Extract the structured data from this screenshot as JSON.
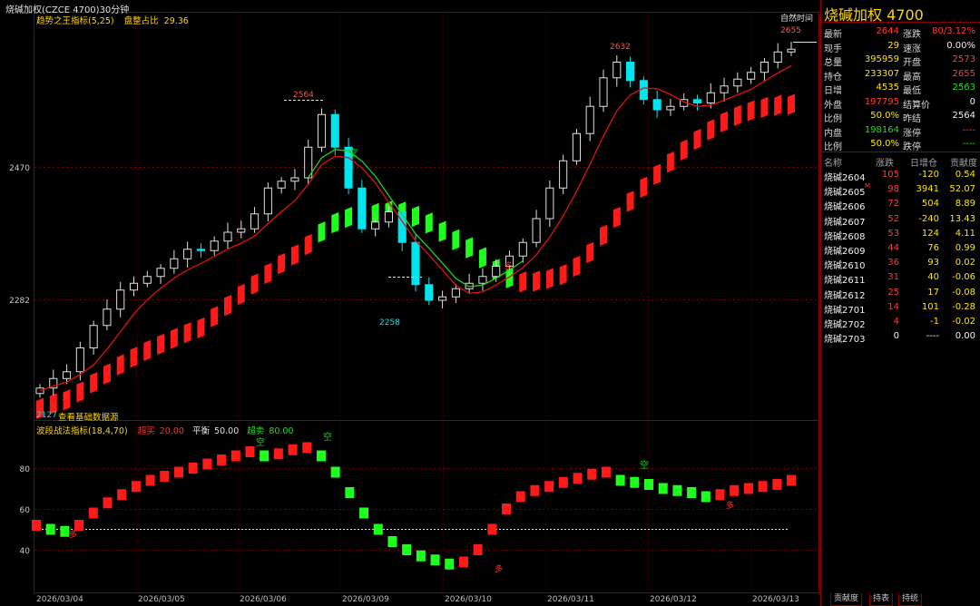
{
  "header": {
    "title": "烧碱加权(CZCE 4700)30分钟",
    "time_label": "自然时间"
  },
  "indicator_main": {
    "name": "趋势之王指标(5,25)",
    "extra_label": "盘整占比",
    "extra_value": "29.36"
  },
  "indicator_sub": {
    "name": "波段战法指标(18,4,70)",
    "overbuy_label": "超买",
    "overbuy_value": "20.00",
    "balance_label": "平衡",
    "balance_value": "50.00",
    "oversell_label": "超卖",
    "oversell_value": "80.00"
  },
  "footer_link": "查看基础数据源",
  "price_axis": {
    "upper": "2470",
    "lower": "2282"
  },
  "osc_axis": {
    "a": "80",
    "b": "60",
    "c": "40"
  },
  "annotations": {
    "high_left": "2564",
    "high_mid": "2632",
    "high_right": "2655",
    "low": "2258",
    "start_low": "2127",
    "short_mark": "空",
    "long_mark": "多"
  },
  "date_labels": [
    "2026/03/04",
    "2026/03/05",
    "2026/03/06",
    "2026/03/09",
    "2026/03/10",
    "2026/03/11",
    "2026/03/12",
    "2026/03/13"
  ],
  "quote": {
    "title": "烧碱加权  4700",
    "rows": [
      {
        "l1": "最新",
        "v1": "2644",
        "c1": "red",
        "l2": "涨跌",
        "v2": "80/3.12%",
        "c2": "red"
      },
      {
        "l1": "现手",
        "v1": "29",
        "c1": "yellow",
        "l2": "速涨",
        "v2": "0.00%",
        "c2": "white"
      },
      {
        "l1": "总量",
        "v1": "395959",
        "c1": "yellow",
        "l2": "开盘",
        "v2": "2573",
        "c2": "red"
      },
      {
        "l1": "持仓",
        "v1": "233307",
        "c1": "yellow",
        "l2": "最高",
        "v2": "2655",
        "c2": "red"
      },
      {
        "l1": "日增",
        "v1": "4535",
        "c1": "yellow",
        "l2": "最低",
        "v2": "2563",
        "c2": "green"
      },
      {
        "l1": "外盘",
        "v1": "197795",
        "c1": "red",
        "l2": "结算价",
        "v2": "0",
        "c2": "white"
      },
      {
        "l1": "比例",
        "v1": "50.0%",
        "c1": "yellow",
        "l2": "昨结",
        "v2": "2564",
        "c2": "white"
      },
      {
        "l1": "内盘",
        "v1": "198164",
        "c1": "green",
        "l2": "涨停",
        "v2": "----",
        "c2": "red"
      },
      {
        "l1": "比例",
        "v1": "50.0%",
        "c1": "yellow",
        "l2": "跌停",
        "v2": "----",
        "c2": "green"
      }
    ]
  },
  "contracts": {
    "headers": [
      "名称",
      "涨跌",
      "日增仓",
      "贡献度"
    ],
    "rows": [
      {
        "name": "烧碱2604",
        "chg": "105",
        "oi": "-120",
        "contrib": "0.54",
        "oi_c": "yellow",
        "chg_c": "red"
      },
      {
        "name": "烧碱2605",
        "tag": "M",
        "chg": "98",
        "oi": "3941",
        "contrib": "52.07",
        "oi_c": "yellow",
        "chg_c": "red"
      },
      {
        "name": "烧碱2606",
        "chg": "72",
        "oi": "504",
        "contrib": "8.89",
        "oi_c": "yellow",
        "chg_c": "red"
      },
      {
        "name": "烧碱2607",
        "chg": "52",
        "oi": "-240",
        "contrib": "13.43",
        "oi_c": "yellow",
        "chg_c": "red"
      },
      {
        "name": "烧碱2608",
        "chg": "53",
        "oi": "124",
        "contrib": "4.11",
        "oi_c": "yellow",
        "chg_c": "red"
      },
      {
        "name": "烧碱2609",
        "chg": "44",
        "oi": "76",
        "contrib": "0.99",
        "oi_c": "yellow",
        "chg_c": "red"
      },
      {
        "name": "烧碱2610",
        "chg": "36",
        "oi": "93",
        "contrib": "0.02",
        "oi_c": "yellow",
        "chg_c": "red"
      },
      {
        "name": "烧碱2611",
        "chg": "31",
        "oi": "40",
        "contrib": "-0.06",
        "oi_c": "yellow",
        "chg_c": "red"
      },
      {
        "name": "烧碱2612",
        "chg": "25",
        "oi": "17",
        "contrib": "-0.08",
        "oi_c": "yellow",
        "chg_c": "red"
      },
      {
        "name": "烧碱2701",
        "chg": "14",
        "oi": "101",
        "contrib": "-0.28",
        "oi_c": "yellow",
        "chg_c": "red"
      },
      {
        "name": "烧碱2702",
        "chg": "4",
        "oi": "-1",
        "contrib": "-0.02",
        "oi_c": "yellow",
        "chg_c": "red"
      },
      {
        "name": "烧碱2703",
        "chg": "0",
        "oi": "----",
        "contrib": "0.00",
        "oi_c": "white",
        "chg_c": "white"
      }
    ]
  },
  "tabs": [
    "贡献度",
    "持表",
    "持统"
  ],
  "colors": {
    "up": "#ff2020",
    "down": "#00e5ee",
    "osc_up": "#ff1a1a",
    "osc_down": "#1eff1e",
    "ma_red": "#e01010",
    "ma_green": "#20d020",
    "grid": "#7a0000",
    "accent": "#ffd700"
  },
  "chart_data": {
    "type": "candlestick",
    "timeframe": "30m",
    "price_range": [
      2127,
      2655
    ],
    "x_dates": [
      "2026/03/04",
      "2026/03/05",
      "2026/03/06",
      "2026/03/09",
      "2026/03/10",
      "2026/03/11",
      "2026/03/12",
      "2026/03/13"
    ],
    "labeled_points": [
      {
        "label": "2564",
        "kind": "high",
        "date": "2026/03/06"
      },
      {
        "label": "2258",
        "kind": "low",
        "date": "2026/03/09"
      },
      {
        "label": "2632",
        "kind": "high",
        "date": "2026/03/11"
      },
      {
        "label": "2655",
        "kind": "high",
        "date": "2026/03/13"
      }
    ],
    "close_path": [
      2146,
      2160,
      2170,
      2205,
      2238,
      2262,
      2290,
      2300,
      2310,
      2322,
      2336,
      2350,
      2348,
      2362,
      2375,
      2380,
      2402,
      2440,
      2450,
      2455,
      2500,
      2548,
      2500,
      2440,
      2380,
      2390,
      2405,
      2360,
      2298,
      2275,
      2280,
      2292,
      2300,
      2310,
      2325,
      2340,
      2360,
      2395,
      2440,
      2480,
      2520,
      2560,
      2602,
      2625,
      2598,
      2570,
      2555,
      2560,
      2570,
      2565,
      2580,
      2590,
      2600,
      2610,
      2625,
      2640,
      2644
    ],
    "oscillator": {
      "name": "波段战法指标",
      "levels": [
        20,
        50,
        80
      ],
      "values": [
        52,
        50,
        49,
        52,
        58,
        63,
        67,
        71,
        74,
        76,
        78,
        80,
        82,
        84,
        86,
        88,
        86,
        87,
        89,
        90,
        86,
        78,
        68,
        58,
        50,
        44,
        40,
        37,
        35,
        33,
        34,
        40,
        50,
        60,
        66,
        69,
        71,
        73,
        75,
        77,
        78,
        74,
        73,
        72,
        70,
        69,
        68,
        66,
        67,
        69,
        70,
        71,
        72,
        74
      ]
    }
  }
}
